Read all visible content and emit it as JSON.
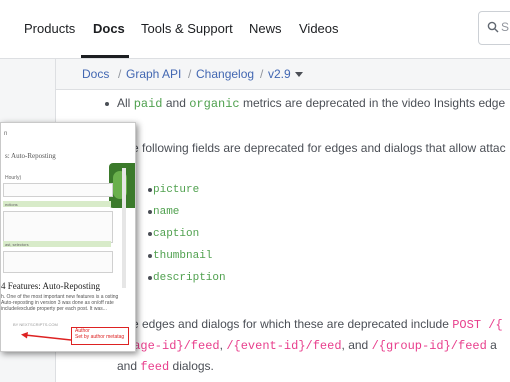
{
  "nav": {
    "items": [
      "Products",
      "Docs",
      "Tools & Support",
      "News",
      "Videos"
    ],
    "active": "Docs",
    "search_label": "S"
  },
  "breadcrumb": {
    "items": [
      "Docs",
      "Graph API",
      "Changelog",
      "v2.9"
    ],
    "separator": "/"
  },
  "content": {
    "line1_prefix": "All",
    "line1_code1": "paid",
    "line1_and": "and",
    "line1_code2": "organic",
    "line1_suffix": "metrics are deprecated in the video Insights edge",
    "line2": "e following fields are deprecated for edges and dialogs that allow attac",
    "fields": [
      "picture",
      "name",
      "caption",
      "thumbnail",
      "description"
    ],
    "line3_prefix": "e edges and dialogs for which these are deprecated include",
    "line3_code": "POST /{",
    "line4_code1": "page-id}/feed",
    "line4_comma": ",",
    "line4_code2": "/{event-id}/feed",
    "line4_and": ", and",
    "line4_code3": "/{group-id}/feed",
    "line4_end": "a",
    "line5_prefix": "and",
    "line5_code": "feed",
    "line5_suffix": "dialogs."
  },
  "overlay": {
    "corner": "n",
    "title": "s: Auto-Reposting",
    "top_label": "Hourly)",
    "heading": "4 Features: Auto-Reposting",
    "para": "h. One of the most important new features is a osting Auto-reposting in version 3 was done as on/off rate include/exclude property per each post. It was...",
    "site": "BY NEXTSCRIPTS.COM",
    "row_label": "ections",
    "row_label2": "ast, selectors",
    "note_line1": "Author",
    "note_line2": "Set by author metatag"
  },
  "colors": {
    "code_green": "#50a14f",
    "code_pink": "#e83e8c",
    "link_blue": "#4267b2",
    "note_red": "#dd2222"
  }
}
